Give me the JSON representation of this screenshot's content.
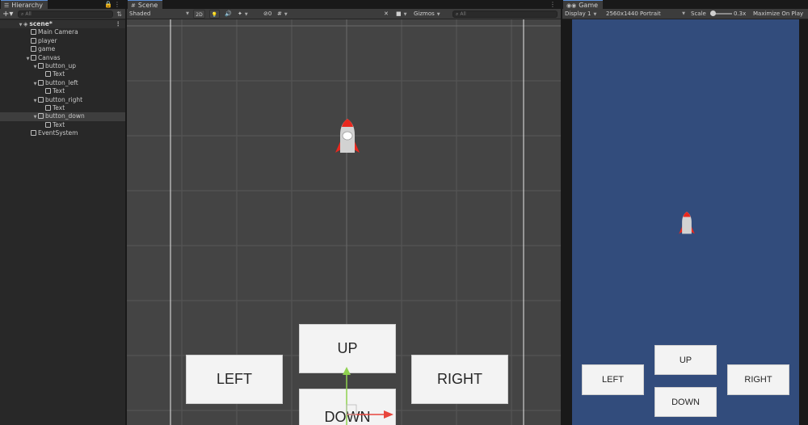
{
  "hierarchy": {
    "tab": "Hierarchy",
    "search_placeholder": "All",
    "tree": [
      {
        "label": "scene*",
        "depth": 0,
        "kind": "scene",
        "expanded": true
      },
      {
        "label": "Main Camera",
        "depth": 1,
        "kind": "object"
      },
      {
        "label": "player",
        "depth": 1,
        "kind": "object"
      },
      {
        "label": "game",
        "depth": 1,
        "kind": "object"
      },
      {
        "label": "Canvas",
        "depth": 1,
        "kind": "object",
        "expanded": true
      },
      {
        "label": "button_up",
        "depth": 2,
        "kind": "object",
        "expanded": true
      },
      {
        "label": "Text",
        "depth": 3,
        "kind": "object"
      },
      {
        "label": "button_left",
        "depth": 2,
        "kind": "object",
        "expanded": true
      },
      {
        "label": "Text",
        "depth": 3,
        "kind": "object"
      },
      {
        "label": "button_right",
        "depth": 2,
        "kind": "object",
        "expanded": true
      },
      {
        "label": "Text",
        "depth": 3,
        "kind": "object"
      },
      {
        "label": "button_down",
        "depth": 2,
        "kind": "object",
        "expanded": true,
        "selected": true
      },
      {
        "label": "Text",
        "depth": 3,
        "kind": "object"
      },
      {
        "label": "EventSystem",
        "depth": 1,
        "kind": "object"
      }
    ]
  },
  "scene": {
    "tab": "Scene",
    "shading_mode": "Shaded",
    "mode_2d": "2D",
    "gizmos": "Gizmos",
    "search_placeholder": "All",
    "hidden_count": "0",
    "buttons": {
      "up": "UP",
      "left": "LEFT",
      "right": "RIGHT",
      "down": "DOWN"
    }
  },
  "game": {
    "tab": "Game",
    "display": "Display 1",
    "resolution": "2560x1440 Portrait",
    "scale_label": "Scale",
    "scale_value": "0.3x",
    "maximize": "Maximize On Play",
    "buttons": {
      "up": "UP",
      "left": "LEFT",
      "right": "RIGHT",
      "down": "DOWN"
    }
  },
  "colors": {
    "game_background": "#324c7c",
    "scene_background": "#444444",
    "rocket_fin": "#e8281e",
    "rocket_body": "#d2d2d2",
    "selection_tab": "#5a8ed6"
  }
}
